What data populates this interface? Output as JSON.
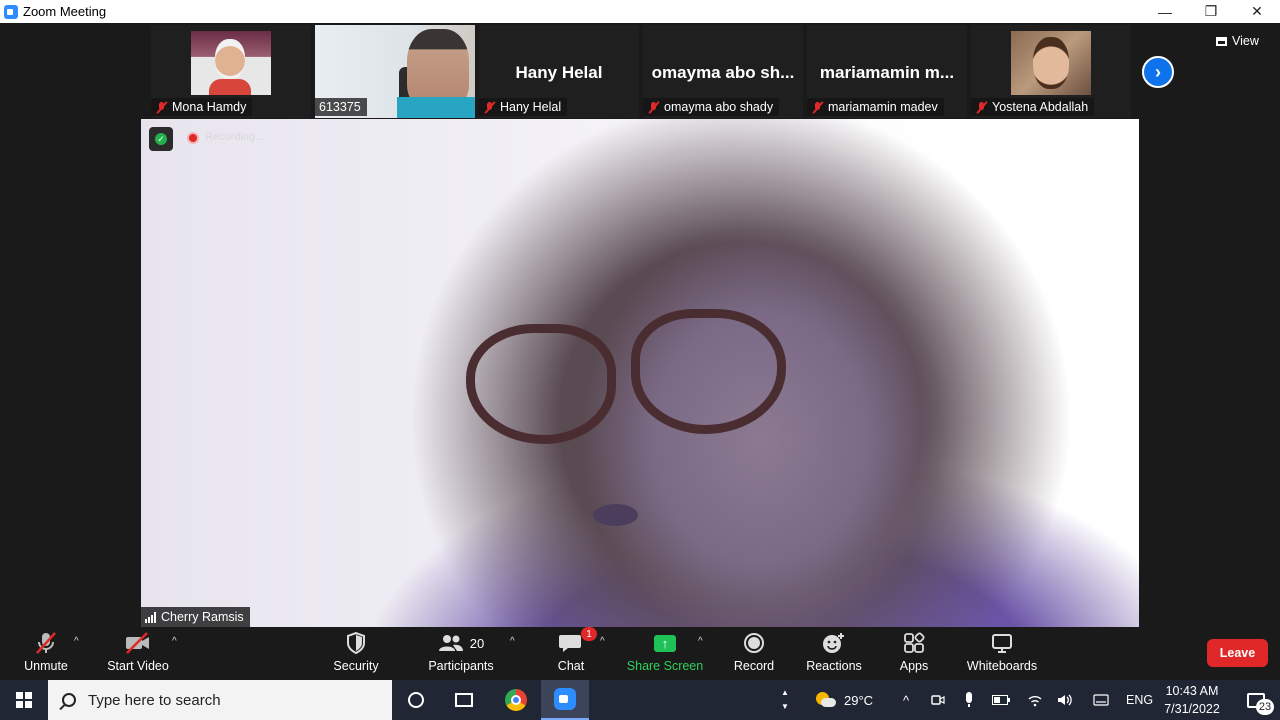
{
  "window": {
    "title": "Zoom Meeting",
    "controls": {
      "minimize": "—",
      "restore": "❐",
      "close": "✕"
    }
  },
  "participants_strip": [
    {
      "name": "Mona Hamdy",
      "muted": true,
      "display": "photo"
    },
    {
      "name": "613375",
      "muted": false,
      "display": "video"
    },
    {
      "name": "Hany Helal",
      "big_name": "Hany Helal",
      "muted": true,
      "display": "name"
    },
    {
      "name": "omayma abo shady",
      "big_name": "omayma  abo  sh...",
      "muted": true,
      "display": "name"
    },
    {
      "name": "mariamamin madev",
      "big_name": "mariamamin  m...",
      "muted": true,
      "display": "name"
    },
    {
      "name": "Yostena Abdallah",
      "muted": true,
      "display": "photo"
    }
  ],
  "strip_next": {
    "icon": "chevron-right-icon",
    "glyph": "›"
  },
  "view_button": {
    "label": "View",
    "icon": "grid-icon"
  },
  "main_video": {
    "speaker": "Cherry Ramsis",
    "recording_label": "Recording...",
    "security_badge_glyph": "✓"
  },
  "toolbar": {
    "unmute": {
      "label": "Unmute",
      "icon": "microphone-muted-icon"
    },
    "start_video": {
      "label": "Start Video",
      "icon": "video-off-icon"
    },
    "security": {
      "label": "Security",
      "icon": "shield-icon"
    },
    "participants": {
      "label": "Participants",
      "count": "20",
      "icon": "participants-icon"
    },
    "chat": {
      "label": "Chat",
      "badge": "1",
      "icon": "chat-icon"
    },
    "share_screen": {
      "label": "Share Screen",
      "icon": "share-screen-icon",
      "glyph": "↑"
    },
    "record": {
      "label": "Record",
      "icon": "record-icon"
    },
    "reactions": {
      "label": "Reactions",
      "icon": "reactions-icon"
    },
    "apps": {
      "label": "Apps",
      "icon": "apps-icon"
    },
    "whiteboards": {
      "label": "Whiteboards",
      "icon": "whiteboard-icon"
    },
    "leave": {
      "label": "Leave"
    },
    "caret_glyph": "^"
  },
  "taskbar": {
    "search_placeholder": "Type here to search",
    "weather": {
      "temperature": "29°C"
    },
    "tray": {
      "chevron": "^",
      "language": "ENG"
    },
    "clock": {
      "time": "10:43 AM",
      "date": "7/31/2022"
    },
    "notifications": {
      "count": "23"
    },
    "scroll_up": "▲",
    "scroll_down": "▼"
  },
  "colors": {
    "accent_blue": "#0e72ed",
    "leave_red": "#e02828",
    "share_green": "#20c257",
    "toolbar_bg": "#1a1a1a",
    "taskbar_bg": "#202633"
  }
}
